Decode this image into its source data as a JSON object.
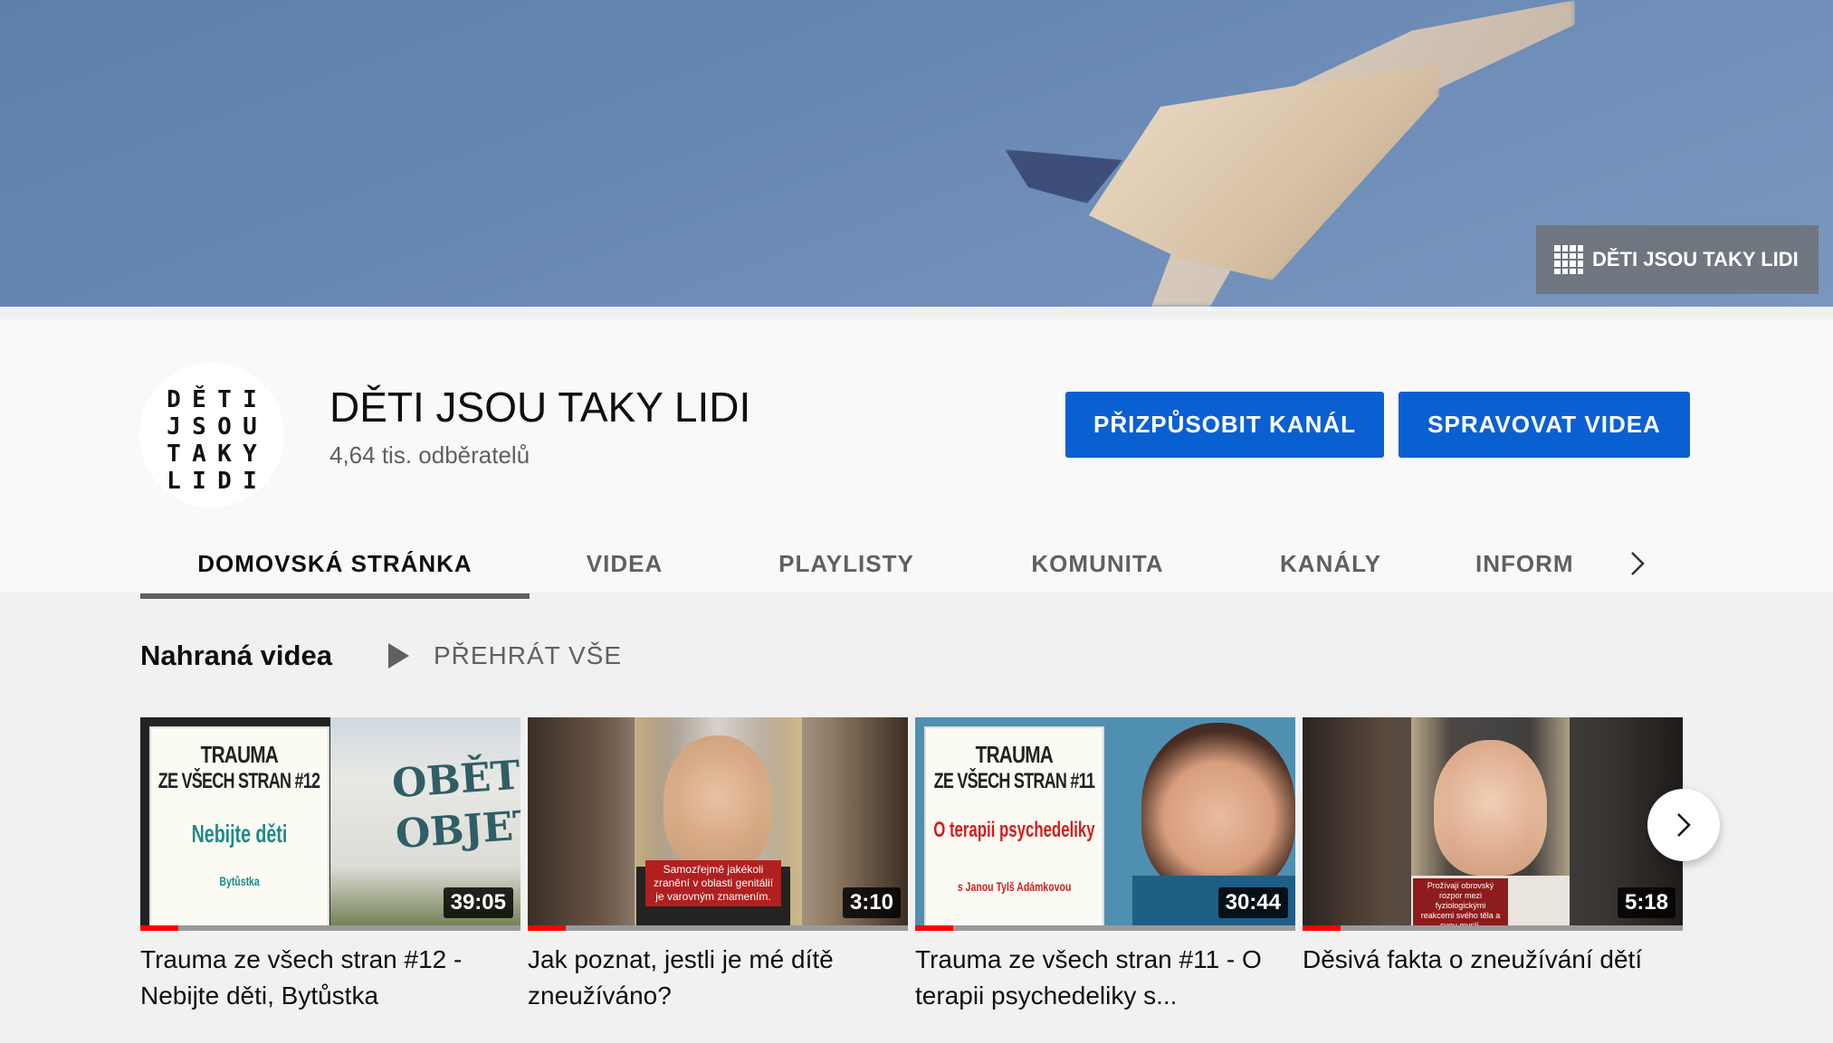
{
  "banner": {
    "link_label": "DĚTI JSOU TAKY LIDI"
  },
  "channel": {
    "avatar_letters": [
      "D",
      "Ě",
      "T",
      "I",
      "J",
      "S",
      "O",
      "U",
      "T",
      "A",
      "K",
      "Y",
      "L",
      "I",
      "D",
      "I"
    ],
    "title": "DĚTI JSOU TAKY LIDI",
    "subscribers": "4,64 tis. odběratelů"
  },
  "actions": {
    "customize": "PŘIZPŮSOBIT KANÁL",
    "manage": "SPRAVOVAT VIDEA"
  },
  "tabs": [
    {
      "label": "DOMOVSKÁ STRÁNKA",
      "active": true
    },
    {
      "label": "VIDEA",
      "active": false
    },
    {
      "label": "PLAYLISTY",
      "active": false
    },
    {
      "label": "KOMUNITA",
      "active": false
    },
    {
      "label": "KANÁLY",
      "active": false
    },
    {
      "label": "INFORM",
      "active": false
    }
  ],
  "section": {
    "title": "Nahraná videa",
    "play_all": "PŘEHRÁT VŠE"
  },
  "videos": [
    {
      "title": "Trauma ze všech stran #12 - Nebijte děti, Bytůstka",
      "duration": "39:05",
      "progress": 0.1,
      "thumb_text": {
        "line1": "TRAUMA",
        "line2": "ZE VŠECH STRAN #12",
        "sub": "Nebijte děti",
        "foot": "Bytůstka",
        "wall": "OBĚTI\nOBJETÍ"
      }
    },
    {
      "title": "Jak poznat, jestli je mé dítě zneužíváno?",
      "duration": "3:10",
      "progress": 0.1,
      "thumb_text": {
        "caption": "Samozřejmě jakékoli zranění v oblasti genitálií je varovným znamením."
      }
    },
    {
      "title": "Trauma ze všech stran #11 - O terapii psychedeliky s...",
      "duration": "30:44",
      "progress": 0.1,
      "thumb_text": {
        "line1": "TRAUMA",
        "line2": "ZE VŠECH STRAN #11",
        "sub": "O terapii psychedeliky",
        "foot": "s Janou Tylš Adámkovou"
      }
    },
    {
      "title": "Děsivá fakta o zneužívání dětí",
      "duration": "5:18",
      "progress": 0.1,
      "thumb_text": {
        "caption": "Prožívají obrovský rozpor mezi fyziologickými reakcemi svého těla a svou myslí."
      }
    }
  ],
  "colors": {
    "accent_button": "#0b60d1",
    "progress_red": "#ff0000",
    "card_green": "#1f8a88",
    "card_red": "#d21e1e"
  }
}
